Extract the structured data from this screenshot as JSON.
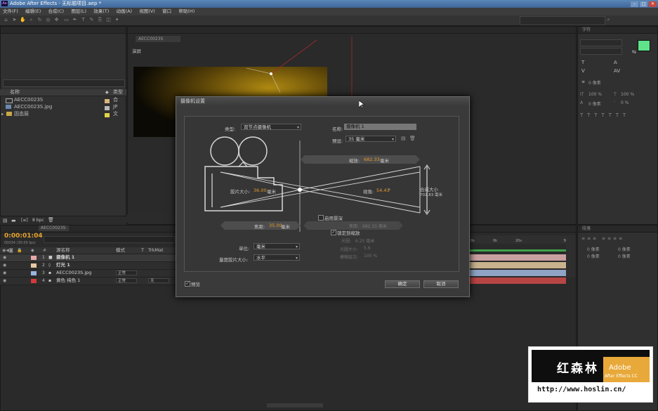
{
  "app": {
    "title": "Adobe After Effects - 无标题项目.aep *",
    "icon_text": "Ae"
  },
  "menu": [
    "文件(F)",
    "编辑(E)",
    "合成(C)",
    "图层(L)",
    "效果(T)",
    "动画(A)",
    "视图(V)",
    "窗口",
    "帮助(H)"
  ],
  "project": {
    "headers": {
      "name": "名称",
      "type": "类型"
    },
    "items": [
      {
        "name": "AECC0023S",
        "type": "合"
      },
      {
        "name": "AECC0023S.jpg",
        "type": "JP"
      },
      {
        "name": "固态层",
        "type": "文"
      }
    ],
    "bpc": "8 bpc"
  },
  "viewer": {
    "label": "演屏",
    "tab": "AECC0023S"
  },
  "timeline": {
    "tab": "AECC0023S",
    "timecode": "0:00:01:04",
    "fps": "00034 (30.00 fps)",
    "headers": {
      "name": "源名称",
      "mode": "模式",
      "t": "T",
      "trkmat": "TrkMat"
    },
    "layers": [
      {
        "num": "1",
        "name": "摄像机 1",
        "color": "#e8a8a8",
        "mode": "",
        "trkmat": ""
      },
      {
        "num": "2",
        "name": "灯光 1",
        "color": "#e8c8a0",
        "mode": "",
        "trkmat": ""
      },
      {
        "num": "3",
        "name": "AECC0023S.jpg",
        "color": "#9ab6e0",
        "mode": "正常",
        "trkmat": ""
      },
      {
        "num": "4",
        "name": "黄色 纯色 1",
        "color": "#d43a3a",
        "mode": "正常",
        "trkmat": "无"
      }
    ],
    "ruler": [
      "0s",
      "0k",
      "20s",
      "30s"
    ],
    "track_colors": [
      "#c9a0a0",
      "#c9b38e",
      "#8fa4c4",
      "#b84545"
    ]
  },
  "dialog": {
    "title": "摄像机设置",
    "type_label": "类型:",
    "type_value": "双节点摄像机",
    "name_label": "名称:",
    "name_value": "摄像机 1",
    "preset_label": "预设:",
    "preset_value": "35 毫米",
    "zoom_label": "缩放:",
    "zoom_value": "682.33",
    "film_label": "胶片大小:",
    "film_value": "36.00",
    "angle_label": "视角:",
    "angle_value": "54.43",
    "angle_unit": "°",
    "comp_label": "合成大小",
    "comp_value": "702.83 毫米",
    "focal_label": "焦距:",
    "focal_value": "35.00",
    "mm": "毫米",
    "dof_label": "启用景深",
    "lock_label": "锁定到缩放",
    "focus_dist_label": "焦距:",
    "focus_dist_value": "682.33 毫米",
    "aperture_label": "光圈:",
    "aperture_value": "6.25 毫米",
    "fstop_label": "光圈大小:",
    "fstop_value": "5.6",
    "blur_label": "模糊层次:",
    "blur_value": "100 %",
    "units_label": "单位:",
    "units_value": "毫米",
    "measure_label": "量度胶片大小:",
    "measure_value": "水平",
    "preview_label": "预览",
    "ok": "确定",
    "cancel": "取消"
  },
  "right_panel": {
    "tab": "字符",
    "swatch_color": "#5fe38a",
    "values": [
      "0 像素",
      "0 像素",
      "100 %",
      "100 %",
      "0 %",
      "0 %"
    ]
  },
  "bottom_right": {
    "tab": "段落",
    "values": [
      "0 像素",
      "0 像素",
      "0 像素",
      "0 像素"
    ]
  },
  "watermark": {
    "cn": "红森林",
    "line1": "Adobe",
    "line2": "After Effects CC",
    "url": "http://www.hoslin.cn/"
  }
}
